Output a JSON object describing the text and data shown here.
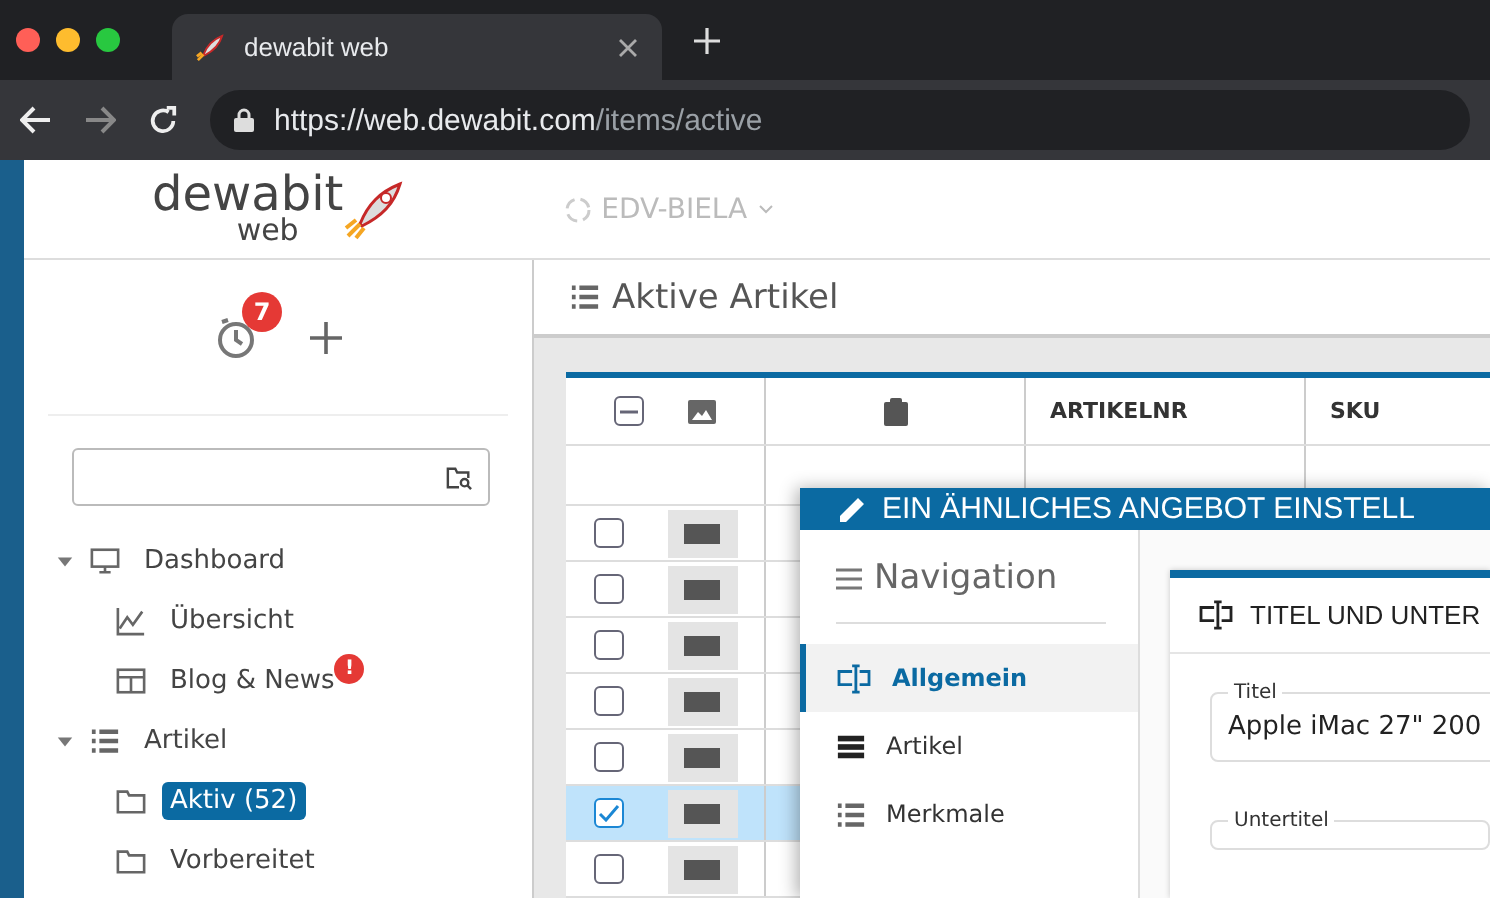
{
  "browser": {
    "tab_title": "dewabit web",
    "url_host": "https://web.dewabit.com",
    "url_path": "/items/active"
  },
  "header": {
    "logo_text": "dewabit",
    "logo_subtext": "web",
    "organization": "EDV-BIELA"
  },
  "sidebar": {
    "timer_badge": "7",
    "tree": [
      {
        "label": "Dashboard",
        "kind": "monitor",
        "expanded": true,
        "children": [
          {
            "label": "Übersicht",
            "kind": "chart",
            "selected": false
          },
          {
            "label": "Blog & News",
            "kind": "news",
            "badge": "!",
            "selected": false
          }
        ]
      },
      {
        "label": "Artikel",
        "kind": "list",
        "expanded": true,
        "children": [
          {
            "label": "Aktiv (52)",
            "kind": "folder",
            "selected": true
          },
          {
            "label": "Vorbereitet",
            "kind": "folder",
            "selected": false
          }
        ]
      }
    ]
  },
  "page_title": "Aktive Artikel",
  "table": {
    "select_all": {
      "indeterminate": true
    },
    "columns": [
      {
        "kind": "clipboard"
      },
      {
        "kind": "text",
        "label": "ARTIKELNR"
      },
      {
        "kind": "text",
        "label": "SKU"
      }
    ],
    "rows": [
      {
        "checked": false
      },
      {
        "checked": false
      },
      {
        "checked": false
      },
      {
        "checked": false
      },
      {
        "checked": false
      },
      {
        "checked": true
      },
      {
        "checked": false
      }
    ]
  },
  "modal": {
    "title": "EIN ÄHNLICHES ANGEBOT EINSTELL",
    "nav_heading": "Navigation",
    "nav_items": [
      {
        "label": "Allgemein",
        "kind": "textcursor",
        "selected": true
      },
      {
        "label": "Artikel",
        "kind": "table",
        "selected": false
      },
      {
        "label": "Merkmale",
        "kind": "list",
        "selected": false
      }
    ],
    "section_title": "TITEL UND UNTER",
    "fields": [
      {
        "label": "Titel",
        "value": "Apple iMac 27\" 200"
      },
      {
        "label": "Untertitel"
      }
    ]
  }
}
